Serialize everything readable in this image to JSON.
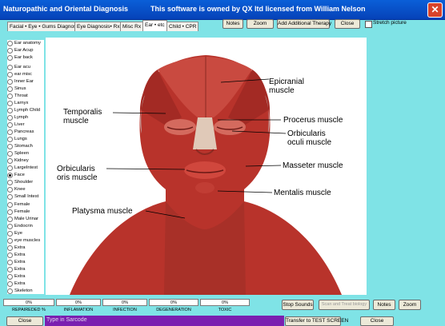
{
  "window": {
    "title": "Naturopathic and Oriental Diagnosis",
    "ownership_notice": "This software is owned by QX ltd licensed from William Nelson"
  },
  "tabs": [
    {
      "label": "Facial • Eye • Gums Diagnosis"
    },
    {
      "label": "Eye Diagnosis• Rx"
    },
    {
      "label": "Misc Rx"
    },
    {
      "label": "Ear • etc"
    },
    {
      "label": "Child • CPR"
    }
  ],
  "toolbar": {
    "notes": "Notes",
    "zoom": "Zoom",
    "add_therapy": "Add Additional Therapy",
    "close": "Close",
    "stretch_label": "Stretch picture"
  },
  "body_parts": [
    "Ear anatomy",
    "Ear Acup",
    "Ear back",
    "Ear acu",
    "ear misc",
    "Inner Ear",
    "Sinus",
    "Throat",
    "Larnyx",
    "Lymph Child",
    "Lymph",
    "Liver",
    "Pancreas",
    "Lungs",
    "Stomach",
    "Spleen",
    "Kidney",
    "LargeIntest",
    "Face",
    "Shoulder",
    "Knee",
    "Small Intest",
    "Female",
    "Female",
    "Male Urinar",
    "Endocrin",
    "Eye",
    "eye muscles",
    "Extra",
    "Extra",
    "Extra",
    "Extra",
    "Extra",
    "Extra",
    "Skeleton"
  ],
  "selected_body_part_index": 18,
  "diagram_labels": {
    "epicranial": "Epicranial muscle",
    "temporalis": "Temporalis muscle",
    "procerus": "Procerus muscle",
    "orbicularis_oculi": "Orbicularis oculi muscle",
    "masseter": "Masseter muscle",
    "orbicularis_oris": "Orbicularis oris muscle",
    "mentalis": "Mentalis muscle",
    "platysma": "Platysma muscle"
  },
  "metrics": [
    {
      "value": "0%",
      "label": "REPAIREDED %"
    },
    {
      "value": "0%",
      "label": "INFLAMATION"
    },
    {
      "value": "0%",
      "label": "INFECTION"
    },
    {
      "value": "0%",
      "label": "DEGENERATION"
    },
    {
      "value": "0%",
      "label": "TOXIC"
    }
  ],
  "bottom": {
    "stop_sounds": "Stop Sounds",
    "scan_treat": "Scan and Treat biology",
    "notes": "Notes",
    "zoom": "Zoom",
    "close_left": "Close",
    "sarcode_placeholder": "Type in Sarcode",
    "transfer": "Transfer to TEST SCREEN",
    "close_right": "Close"
  },
  "colors": {
    "window_bg": "#7fe3e6",
    "titlebar": "#0642b8",
    "sarcode_bg": "#7a1fb0",
    "muscle": "#b8332b"
  }
}
